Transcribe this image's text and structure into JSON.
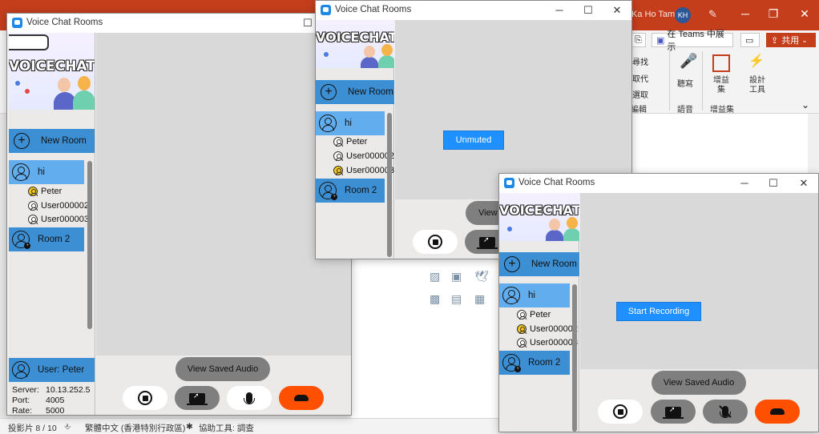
{
  "powerpoint": {
    "user_name": "Ka Ho Tam",
    "avatar_initials": "KH",
    "teams_button": "在 Teams 中展示",
    "share_button": "共用",
    "copy_fragment": "製",
    "find_label": "尋找",
    "replace_label": "取代",
    "select_label": "選取",
    "editing_group": "編輯",
    "dictate_label": "聽寫",
    "voice_group": "語音",
    "addins_label": "增益集",
    "addins_group": "增益集",
    "designer_label": "設計工具",
    "status_slide": "投影片 8 / 10",
    "status_language": "繁體中文 (香港特別行政區)",
    "status_accessibility": "協助工具: 調查"
  },
  "app_title": "Voice Chat Rooms",
  "banner_text": "VOICECHAT",
  "new_room_label": "New Room",
  "rooms": [
    {
      "name": "hi",
      "members": [
        "Peter",
        "User000002",
        "User000003"
      ]
    },
    {
      "name": "Room 2",
      "members": []
    }
  ],
  "view_saved_audio": "View Saved Audio",
  "view_saved_audio_short": "View",
  "window1": {
    "speaking": "Peter",
    "current_user": "User: Peter",
    "server_label": "Server:",
    "server_value": "10.13.252.5",
    "port_label": "Port:",
    "port_value": "4005",
    "rate_label": "Rate:",
    "rate_value": "5000"
  },
  "window2": {
    "speaking": "User000003",
    "status_button": "Unmuted"
  },
  "window3": {
    "speaking": "User000002",
    "status_button": "Start Recording"
  },
  "colors": {
    "accent_blue": "#1e90ff",
    "room_selected": "#62adee",
    "room_default": "#3d8fd4",
    "hangup": "#ff4f00",
    "speaking": "#f3c518"
  },
  "icons": [
    "stop-record-icon",
    "share-screen-icon",
    "microphone-icon",
    "microphone-muted-icon",
    "hang-up-icon",
    "plus-circle-icon",
    "user-circle-icon",
    "group-icon"
  ]
}
